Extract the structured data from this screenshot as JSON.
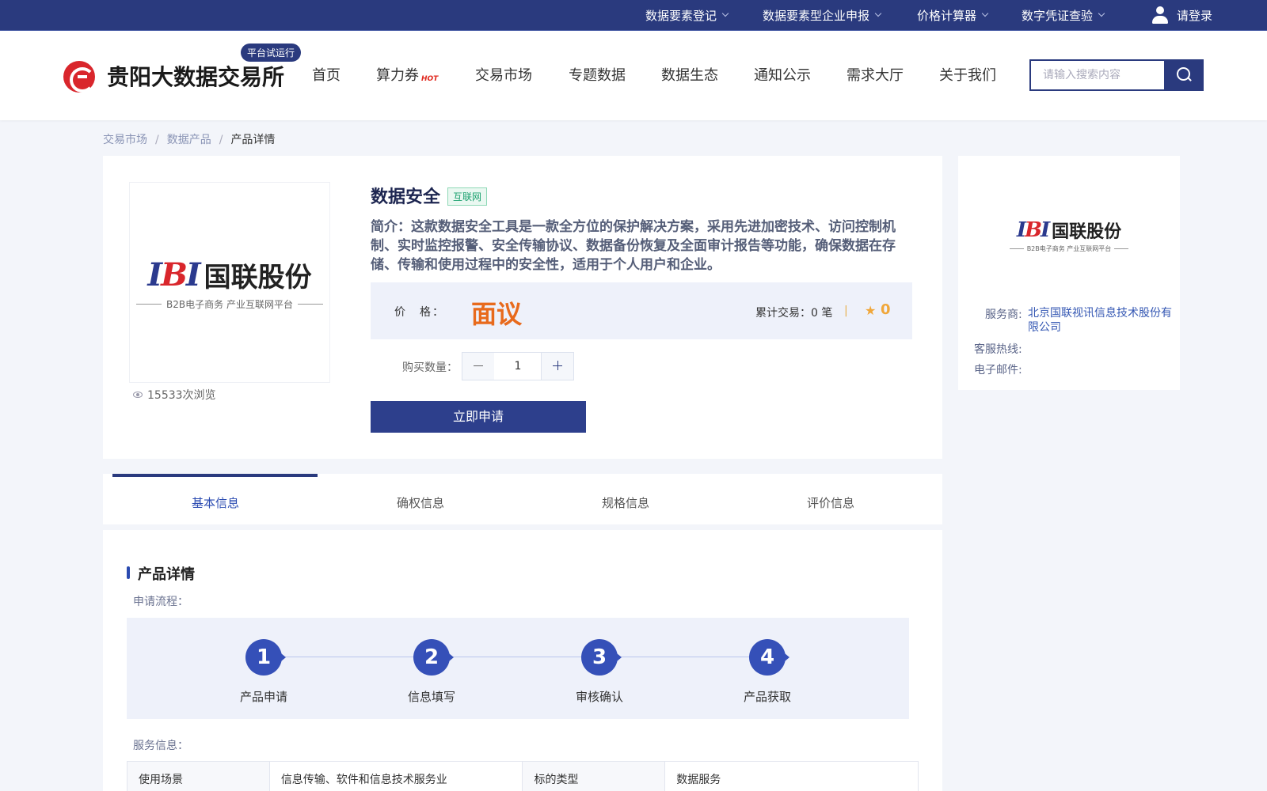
{
  "topbar": {
    "items": [
      {
        "label": "数据要素登记"
      },
      {
        "label": "数据要素型企业申报"
      },
      {
        "label": "价格计算器"
      },
      {
        "label": "数字凭证查验"
      }
    ],
    "login_label": "请登录"
  },
  "header": {
    "site_name": "贵阳大数据交易所",
    "trial_badge": "平台试运行",
    "nav": [
      {
        "label": "首页"
      },
      {
        "label": "算力券",
        "badge": "HOT"
      },
      {
        "label": "交易市场"
      },
      {
        "label": "专题数据"
      },
      {
        "label": "数据生态"
      },
      {
        "label": "通知公示"
      },
      {
        "label": "需求大厅"
      },
      {
        "label": "关于我们"
      }
    ],
    "search_placeholder": "请输入搜索内容"
  },
  "breadcrumb": [
    "交易市场",
    "数据产品",
    "产品详情"
  ],
  "product": {
    "logo": {
      "mark": "IBI",
      "name": "国联股份",
      "tagline": "B2B电子商务 产业互联网平台"
    },
    "views": "15533次浏览",
    "title": "数据安全",
    "tag": "互联网",
    "description": "简介：这款数据安全工具是一款全方位的保护解决方案，采用先进加密技术、访问控制机制、实时监控报警、安全传输协议、数据备份恢复及全面审计报告等功能，确保数据在存储、传输和使用过程中的安全性，适用于个人用户和企业。",
    "price_label": "价　格：",
    "price_value": "面议",
    "trade_count": "累计交易：0 笔",
    "separator": "|",
    "rating": "0",
    "qty_label": "购买数量：",
    "qty_value": "1",
    "apply_label": "立即申请"
  },
  "provider": {
    "service_label": "服务商:",
    "service_value": "北京国联视讯信息技术股份有限公司",
    "hotline_label": "客服热线:",
    "email_label": "电子邮件:"
  },
  "tabs": [
    {
      "label": "基本信息",
      "active": true
    },
    {
      "label": "确权信息",
      "active": false
    },
    {
      "label": "规格信息",
      "active": false
    },
    {
      "label": "评价信息",
      "active": false
    }
  ],
  "details": {
    "section_title": "产品详情",
    "flow_label": "申请流程：",
    "steps": [
      {
        "num": "1",
        "label": "产品申请"
      },
      {
        "num": "2",
        "label": "信息填写"
      },
      {
        "num": "3",
        "label": "审核确认"
      },
      {
        "num": "4",
        "label": "产品获取"
      }
    ],
    "service_label": "服务信息：",
    "table": [
      [
        "使用场景",
        "信息传输、软件和信息技术服务业",
        "标的类型",
        "数据服务"
      ]
    ]
  },
  "colors": {
    "primary": "#2a3a7e",
    "accent_orange": "#e86a1c",
    "link_blue": "#3457b3",
    "tag_green": "#1aa06e"
  }
}
